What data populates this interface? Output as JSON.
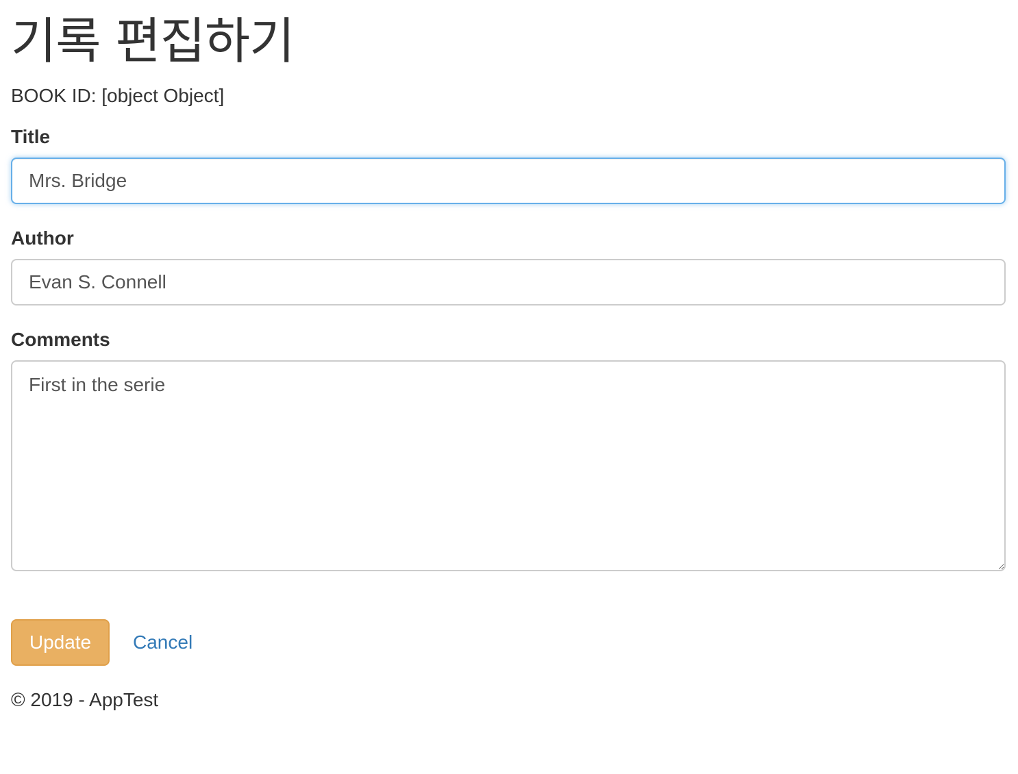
{
  "page": {
    "title": "기록 편집하기",
    "book_id": "BOOK ID: [object Object]"
  },
  "form": {
    "title_label": "Title",
    "title_value": "Mrs. Bridge",
    "author_label": "Author",
    "author_value": "Evan S. Connell",
    "comments_label": "Comments",
    "comments_value": "First in the serie",
    "update_label": "Update",
    "cancel_label": "Cancel"
  },
  "footer": {
    "text": "© 2019 - AppTest"
  },
  "colors": {
    "update_button": "#e9b062",
    "link": "#337ab7",
    "focus_border": "#66afe9"
  }
}
